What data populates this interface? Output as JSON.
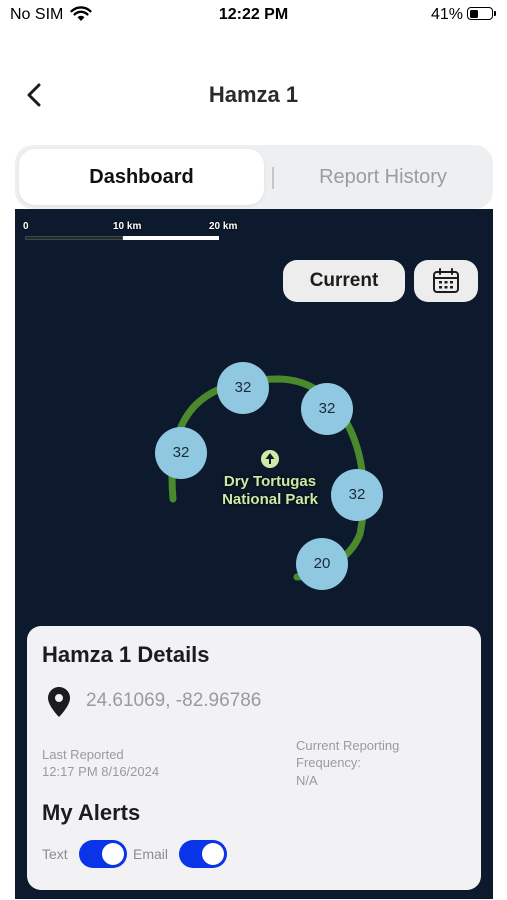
{
  "status_bar": {
    "carrier": "No SIM",
    "time": "12:22 PM",
    "battery_percent": "41%",
    "battery_level": 0.41
  },
  "nav": {
    "title": "Hamza 1",
    "back_icon": "chevron-left-icon"
  },
  "tabs": [
    {
      "label": "Dashboard",
      "active": true
    },
    {
      "label": "Report History",
      "active": false
    }
  ],
  "map": {
    "scale_labels": [
      "0",
      "10 km",
      "20 km"
    ],
    "current_label": "Current",
    "calendar_icon": "calendar-icon",
    "clusters": [
      "32",
      "32",
      "32",
      "32",
      "20"
    ],
    "park_name_line1": "Dry Tortugas",
    "park_name_line2": "National Park",
    "track_color": "#4a8a2c",
    "cluster_color": "#8fc8e0"
  },
  "details": {
    "title": "Hamza 1 Details",
    "coordinates": "24.61069, -82.96786",
    "last_reported_label": "Last Reported",
    "last_reported_value": "12:17 PM 8/16/2024",
    "frequency_label_line1": "Current Reporting",
    "frequency_label_line2": "Frequency:",
    "frequency_value": "N/A"
  },
  "alerts": {
    "title": "My Alerts",
    "text_label": "Text",
    "text_enabled": true,
    "email_label": "Email",
    "email_enabled": true,
    "toggle_color": "#0a34e8"
  }
}
